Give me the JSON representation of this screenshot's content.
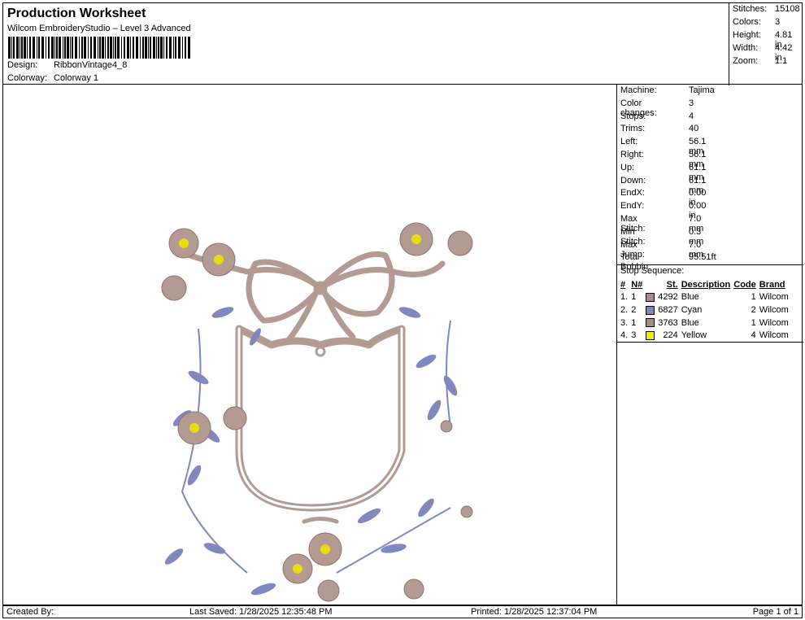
{
  "header": {
    "title": "Production Worksheet",
    "subtitle": "Wilcom EmbroideryStudio – Level 3 Advanced",
    "design_label": "Design:",
    "design_value": "RibbonVintage4_8",
    "colorway_label": "Colorway:",
    "colorway_value": "Colorway 1"
  },
  "summary": [
    {
      "label": "Stitches:",
      "value": "15108"
    },
    {
      "label": "Colors:",
      "value": "3"
    },
    {
      "label": "Height:",
      "value": "4.81 in"
    },
    {
      "label": "Width:",
      "value": "4.42 in"
    },
    {
      "label": "Zoom:",
      "value": "1:1"
    }
  ],
  "machine_info": [
    {
      "label": "Machine:",
      "value": "Tajima"
    },
    {
      "label": "Color changes:",
      "value": "3"
    },
    {
      "label": "Stops:",
      "value": "4"
    },
    {
      "label": "Trims:",
      "value": "40"
    },
    {
      "label": "Left:",
      "value": "56.1 mm"
    },
    {
      "label": "Right:",
      "value": "56.1 mm"
    },
    {
      "label": "Up:",
      "value": "61.1 mm"
    },
    {
      "label": "Down:",
      "value": "61.1 mm"
    },
    {
      "label": "EndX:",
      "value": "0.00 in"
    },
    {
      "label": "EndY:",
      "value": "0.00 in"
    },
    {
      "label": "Max Stitch:",
      "value": "7.0 mm"
    },
    {
      "label": "Min Stitch:",
      "value": "0.3 mm"
    },
    {
      "label": "Max Jump:",
      "value": "7.0 mm"
    },
    {
      "label": "Total Bobbin:",
      "value": "95.51ft"
    }
  ],
  "stop_sequence": {
    "heading": "Stop Sequence:",
    "columns": [
      "#",
      "N#",
      "St.",
      "Description",
      "Code",
      "Brand"
    ],
    "rows": [
      {
        "num": "1.",
        "n": "1",
        "color": "#a98b86",
        "st": "4292",
        "desc": "Blue",
        "code": "1",
        "brand": "Wilcom"
      },
      {
        "num": "2.",
        "n": "2",
        "color": "#7d86b8",
        "st": "6827",
        "desc": "Cyan",
        "code": "2",
        "brand": "Wilcom"
      },
      {
        "num": "3.",
        "n": "1",
        "color": "#a98b86",
        "st": "3763",
        "desc": "Blue",
        "code": "1",
        "brand": "Wilcom"
      },
      {
        "num": "4.",
        "n": "3",
        "color": "#f2ea00",
        "st": "224",
        "desc": "Yellow",
        "code": "4",
        "brand": "Wilcom"
      }
    ]
  },
  "footer": {
    "created_by": "Created By:",
    "last_saved": "Last Saved: 1/28/2025 12:35:48 PM",
    "printed": "Printed: 1/28/2025 12:37:04 PM",
    "page": "Page 1 of 1"
  },
  "design_colors": {
    "ribbon": "#b39a93",
    "leaf": "#8088bf",
    "center": "#e8dc10"
  }
}
